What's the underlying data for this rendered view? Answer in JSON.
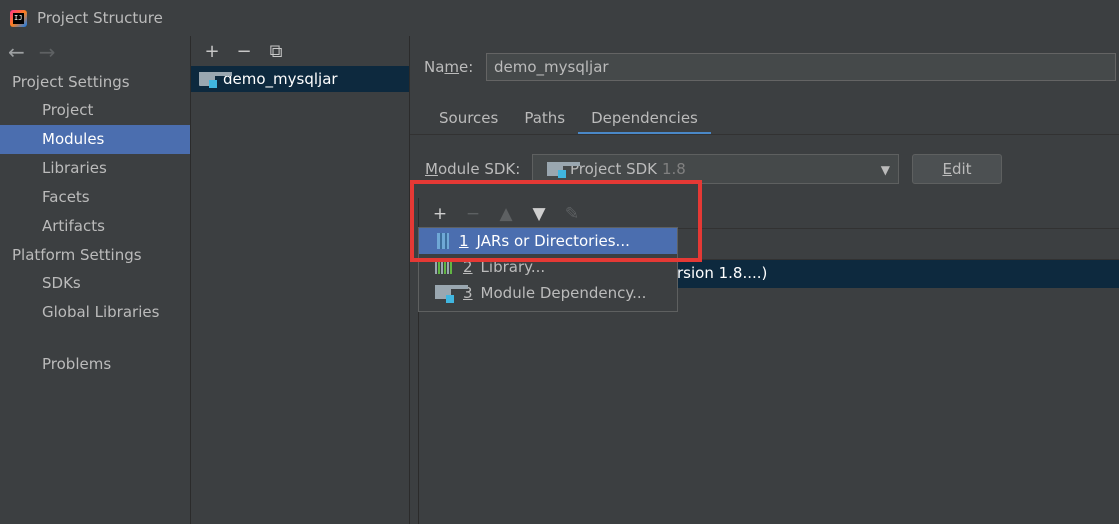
{
  "window": {
    "title": "Project Structure"
  },
  "nav": {
    "back": "←",
    "forward": "→"
  },
  "sidebar": {
    "project_settings_header": "Project Settings",
    "project_items": [
      "Project",
      "Modules",
      "Libraries",
      "Facets",
      "Artifacts"
    ],
    "platform_settings_header": "Platform Settings",
    "platform_items": [
      "SDKs",
      "Global Libraries"
    ],
    "problems": "Problems",
    "selected": "Modules"
  },
  "modules_toolbar": {
    "add": "+",
    "remove": "−",
    "copy": "⧉"
  },
  "modules": [
    "demo_mysqljar"
  ],
  "module_form": {
    "name_label_prefix": "Na",
    "name_label_mnemonic": "m",
    "name_label_suffix": "e:",
    "name_value": "demo_mysqljar",
    "tabs": [
      "Sources",
      "Paths",
      "Dependencies"
    ],
    "active_tab": "Dependencies",
    "sdk_label_mnemonic": "M",
    "sdk_label_suffix": "odule SDK:",
    "sdk_value": "Project SDK",
    "sdk_version": "1.8",
    "edit_mnemonic": "E",
    "edit_suffix": "dit"
  },
  "deps_toolbar": {
    "add": "+",
    "remove": "−",
    "up": "▲",
    "down": "▼",
    "edit": "✎"
  },
  "deps_row_text": "rsion 1.8....)",
  "popup_menu": [
    {
      "num": "1",
      "label": "JARs or Directories...",
      "icon": "jar-icon"
    },
    {
      "num": "2",
      "label": "Library...",
      "icon": "library-icon"
    },
    {
      "num": "3",
      "label": "Module Dependency...",
      "icon": "module-icon"
    }
  ],
  "colors": {
    "selection": "#4b6eaf",
    "highlight_box": "#e53935",
    "background": "#3c3f41"
  }
}
